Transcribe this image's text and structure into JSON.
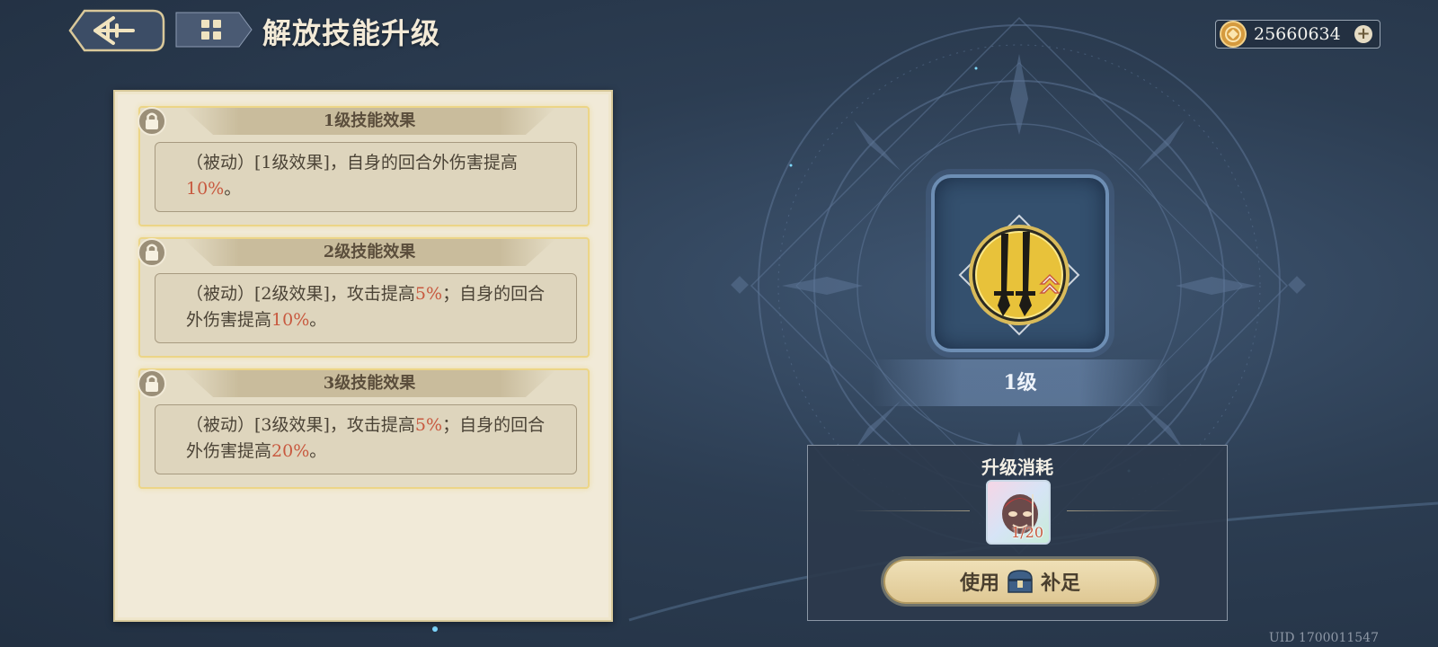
{
  "header": {
    "back_icon": "back-arrow-icon",
    "menu_icon": "menu-grid-icon",
    "title": "解放技能升级"
  },
  "currency": {
    "icon": "coin-icon",
    "value": "25660634",
    "add": "+"
  },
  "effects": [
    {
      "title": "1级技能效果",
      "text_before": "（被动）[1级效果]，自身的回合外伤害提高",
      "highlight": "10%",
      "text_after": "。",
      "locked": true
    },
    {
      "title": "2级技能效果",
      "text_before": "（被动）[2级效果]，攻击提高",
      "highlight": "5%",
      "text_middle": "；自身的回合外伤害提高",
      "highlight2": "10%",
      "text_after": "。",
      "locked": true
    },
    {
      "title": "3级技能效果",
      "text_before": "（被动）[3级效果]，攻击提高",
      "highlight": "5%",
      "text_middle": "；自身的回合外伤害提高",
      "highlight2": "20%",
      "text_after": "。",
      "locked": true
    }
  ],
  "skill": {
    "icon": "twin-blades-skill-icon",
    "level_label": "1级"
  },
  "cost": {
    "title": "升级消耗",
    "item_icon": "mask-item-icon",
    "item_count": "1/20",
    "use_label": "使用",
    "use_icon": "chest-icon",
    "fill_label": "补足"
  },
  "uid": "UID 1700011547",
  "colors": {
    "highlight": "#c8593f",
    "panel_bg": "#f1ead8",
    "card_border": "#ecd587",
    "bg_dark": "#223042"
  }
}
